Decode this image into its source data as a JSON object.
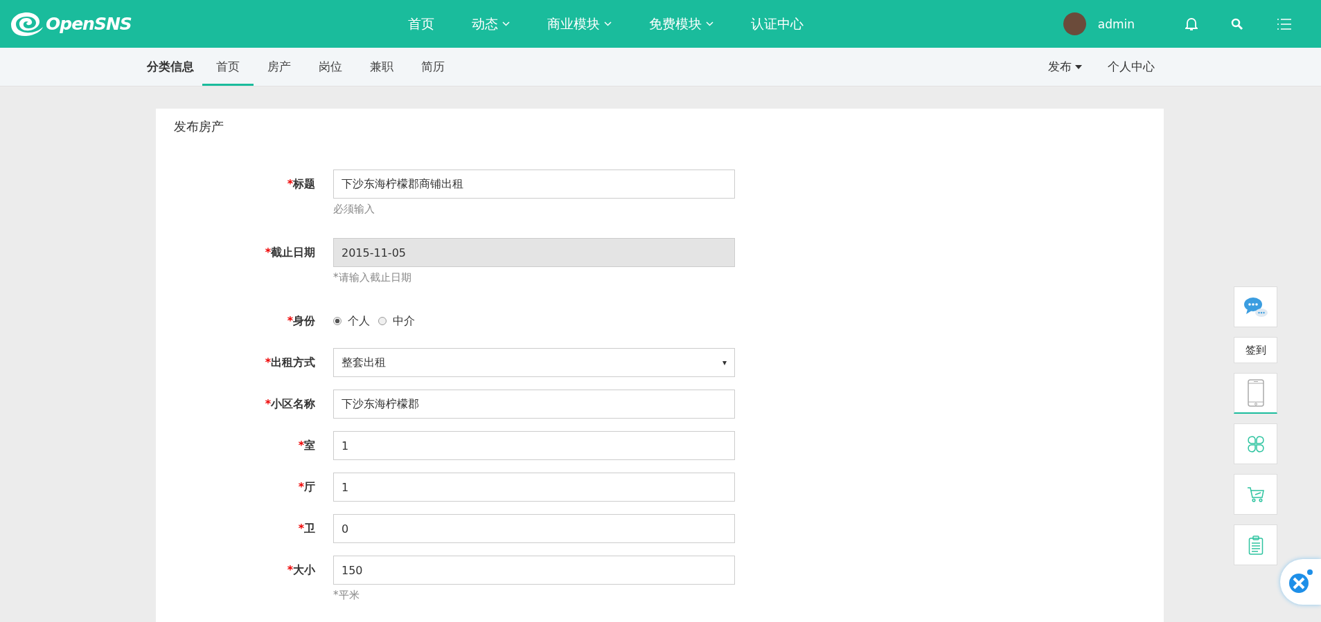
{
  "logo": {
    "text": "OpenSNS"
  },
  "nav": [
    {
      "label": "首页",
      "dropdown": false
    },
    {
      "label": "动态",
      "dropdown": true
    },
    {
      "label": "商业模块",
      "dropdown": true
    },
    {
      "label": "免费模块",
      "dropdown": true
    },
    {
      "label": "认证中心",
      "dropdown": false
    }
  ],
  "user": {
    "name": "admin"
  },
  "subnav": {
    "title": "分类信息",
    "tabs": [
      {
        "label": "首页",
        "selected": true
      },
      {
        "label": "房产",
        "selected": false
      },
      {
        "label": "岗位",
        "selected": false
      },
      {
        "label": "兼职",
        "selected": false
      },
      {
        "label": "简历",
        "selected": false
      }
    ],
    "right": [
      {
        "label": "发布",
        "dropdown": true
      },
      {
        "label": "个人中心",
        "dropdown": false
      }
    ]
  },
  "form": {
    "title": "发布房产",
    "fields": [
      {
        "kind": "text",
        "mark": "*",
        "label": "标题",
        "value": "下沙东海柠檬郡商铺出租",
        "disabled": false,
        "hint": "必须输入"
      },
      {
        "kind": "text",
        "mark": "*",
        "label": "截止日期",
        "value": "2015-11-05",
        "disabled": true,
        "hint": "*请输入截止日期"
      },
      {
        "kind": "radio",
        "mark": "*",
        "label": "身份",
        "options": [
          {
            "label": "个人",
            "selected": true
          },
          {
            "label": "中介",
            "selected": false
          }
        ]
      },
      {
        "kind": "select",
        "mark": "*",
        "label": "出租方式",
        "value": "整套出租",
        "arrow": "▾"
      },
      {
        "kind": "text",
        "mark": "*",
        "label": "小区名称",
        "value": "下沙东海柠檬郡",
        "disabled": false
      },
      {
        "kind": "text",
        "mark": "*",
        "label": "室",
        "value": "1",
        "disabled": false
      },
      {
        "kind": "text",
        "mark": "*",
        "label": "厅",
        "value": "1",
        "disabled": false
      },
      {
        "kind": "text",
        "mark": "*",
        "label": "卫",
        "value": "0",
        "disabled": false
      },
      {
        "kind": "text",
        "mark": "*",
        "label": "大小",
        "value": "150",
        "disabled": false,
        "hint": "*平米"
      }
    ]
  },
  "side_tools": [
    {
      "kind": "chat",
      "selected": false
    },
    {
      "kind": "text",
      "label": "签到",
      "selected": false
    },
    {
      "kind": "phone",
      "selected": true
    },
    {
      "kind": "apps",
      "selected": false
    },
    {
      "kind": "cart",
      "selected": false
    },
    {
      "kind": "clipboard",
      "selected": false
    }
  ]
}
